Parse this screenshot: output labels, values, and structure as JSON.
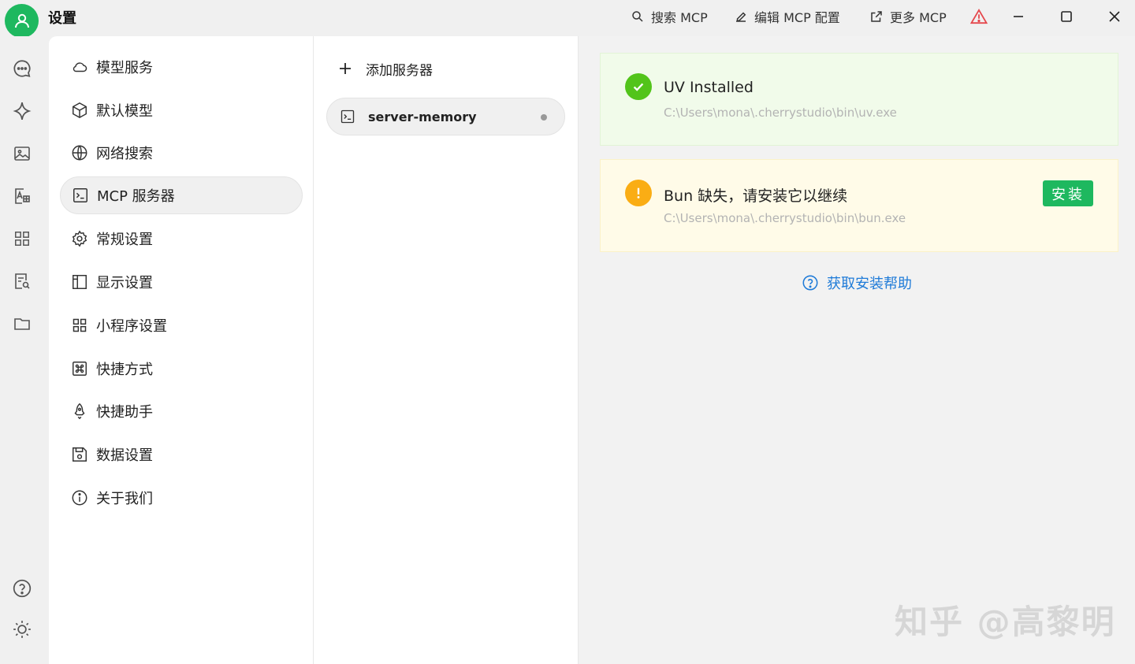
{
  "titlebar": {
    "app_title": "设置",
    "actions": {
      "search_mcp": "搜索 MCP",
      "edit_mcp_config": "编辑 MCP 配置",
      "more_mcp": "更多 MCP"
    },
    "warning_color": "#e5484d"
  },
  "rail": {
    "top_icons": [
      "chat-icon",
      "sparkle-icon",
      "image-icon",
      "translate-icon",
      "apps-icon",
      "file-search-icon",
      "folder-icon"
    ],
    "bottom_icons": [
      "help-icon",
      "sun-icon"
    ]
  },
  "settings_nav": {
    "items": [
      {
        "label": "模型服务",
        "icon": "cloud-icon"
      },
      {
        "label": "默认模型",
        "icon": "cube-icon"
      },
      {
        "label": "网络搜索",
        "icon": "globe-icon"
      },
      {
        "label": "MCP 服务器",
        "icon": "terminal-icon"
      },
      {
        "label": "常规设置",
        "icon": "gear-icon"
      },
      {
        "label": "显示设置",
        "icon": "layout-icon"
      },
      {
        "label": "小程序设置",
        "icon": "grid-icon"
      },
      {
        "label": "快捷方式",
        "icon": "command-icon"
      },
      {
        "label": "快捷助手",
        "icon": "rocket-icon"
      },
      {
        "label": "数据设置",
        "icon": "save-icon"
      },
      {
        "label": "关于我们",
        "icon": "info-icon"
      }
    ],
    "active_index": 3
  },
  "servers": {
    "add_label": "添加服务器",
    "items": [
      {
        "name": "server-memory"
      }
    ]
  },
  "main": {
    "uv_card": {
      "title": "UV Installed",
      "path": "C:\\Users\\mona\\.cherrystudio\\bin\\uv.exe",
      "status_color": "#52c41a"
    },
    "bun_card": {
      "title": "Bun 缺失，请安装它以继续",
      "path": "C:\\Users\\mona\\.cherrystudio\\bin\\bun.exe",
      "install_label": "安装",
      "status_color": "#faad14"
    },
    "help_label": "获取安装帮助",
    "watermark": "知乎 @高黎明"
  },
  "colors": {
    "accent": "#1eb85f",
    "link": "#1f7bd8"
  }
}
